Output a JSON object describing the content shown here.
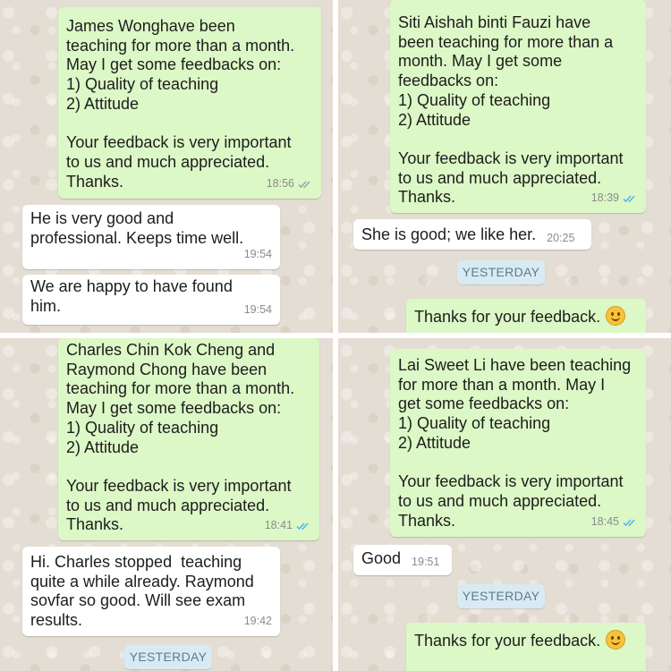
{
  "panels": [
    {
      "out_message": {
        "text": "James Wonghave been\nteaching for more than a month.\nMay I get some feedbacks on:\n1) Quality of teaching\n2) Attitude\n\nYour feedback is very important\nto us and much appreciated.\nThanks.",
        "time": "18:56",
        "status": "delivered"
      },
      "in_messages": [
        {
          "text": "He is very good and\nprofessional. Keeps time well.",
          "time": "19:54"
        },
        {
          "text": "We are happy to have found\nhim.",
          "time": "19:54"
        }
      ]
    },
    {
      "out_message": {
        "text": "Siti Aishah binti Fauzi have\nbeen teaching for more than a\nmonth. May I get some\nfeedbacks on:\n1) Quality of teaching\n2) Attitude\n\nYour feedback is very important\nto us and much appreciated.\nThanks.",
        "time": "18:39",
        "status": "read"
      },
      "in_messages": [
        {
          "text": "She is good; we like her.",
          "time": "20:25"
        }
      ],
      "date_divider": "YESTERDAY",
      "reply": {
        "text": "Thanks for your feedback.",
        "emoji": "smiling-face-icon"
      }
    },
    {
      "out_message": {
        "text": "Charles Chin Kok Cheng and\nRaymond Chong have been\nteaching for more than a month.\nMay I get some feedbacks on:\n1) Quality of teaching\n2) Attitude\n\nYour feedback is very important\nto us and much appreciated.\nThanks.",
        "time": "18:41",
        "status": "read"
      },
      "in_messages": [
        {
          "text": "Hi. Charles stopped  teaching\nquite a while already. Raymond\nsovfar so good. Will see exam\nresults.",
          "time": "19:42"
        }
      ],
      "date_divider": "YESTERDAY"
    },
    {
      "out_message": {
        "text": "Lai Sweet Li have been teaching\nfor more than a month. May I\nget some feedbacks on:\n1) Quality of teaching\n2) Attitude\n\nYour feedback is very important\nto us and much appreciated.\nThanks.",
        "time": "18:45",
        "status": "read"
      },
      "in_messages": [
        {
          "text": "Good",
          "time": "19:51"
        }
      ],
      "date_divider": "YESTERDAY",
      "reply": {
        "text": "Thanks for your feedback.",
        "emoji": "smiling-face-icon"
      }
    }
  ],
  "colors": {
    "outgoing_bubble": "#dcf8c6",
    "incoming_bubble": "#ffffff",
    "chat_background": "#e4ddd3",
    "read_ticks": "#4fb6ec",
    "delivered_ticks": "#9aa3a8",
    "date_pill": "#d8eaf3"
  }
}
